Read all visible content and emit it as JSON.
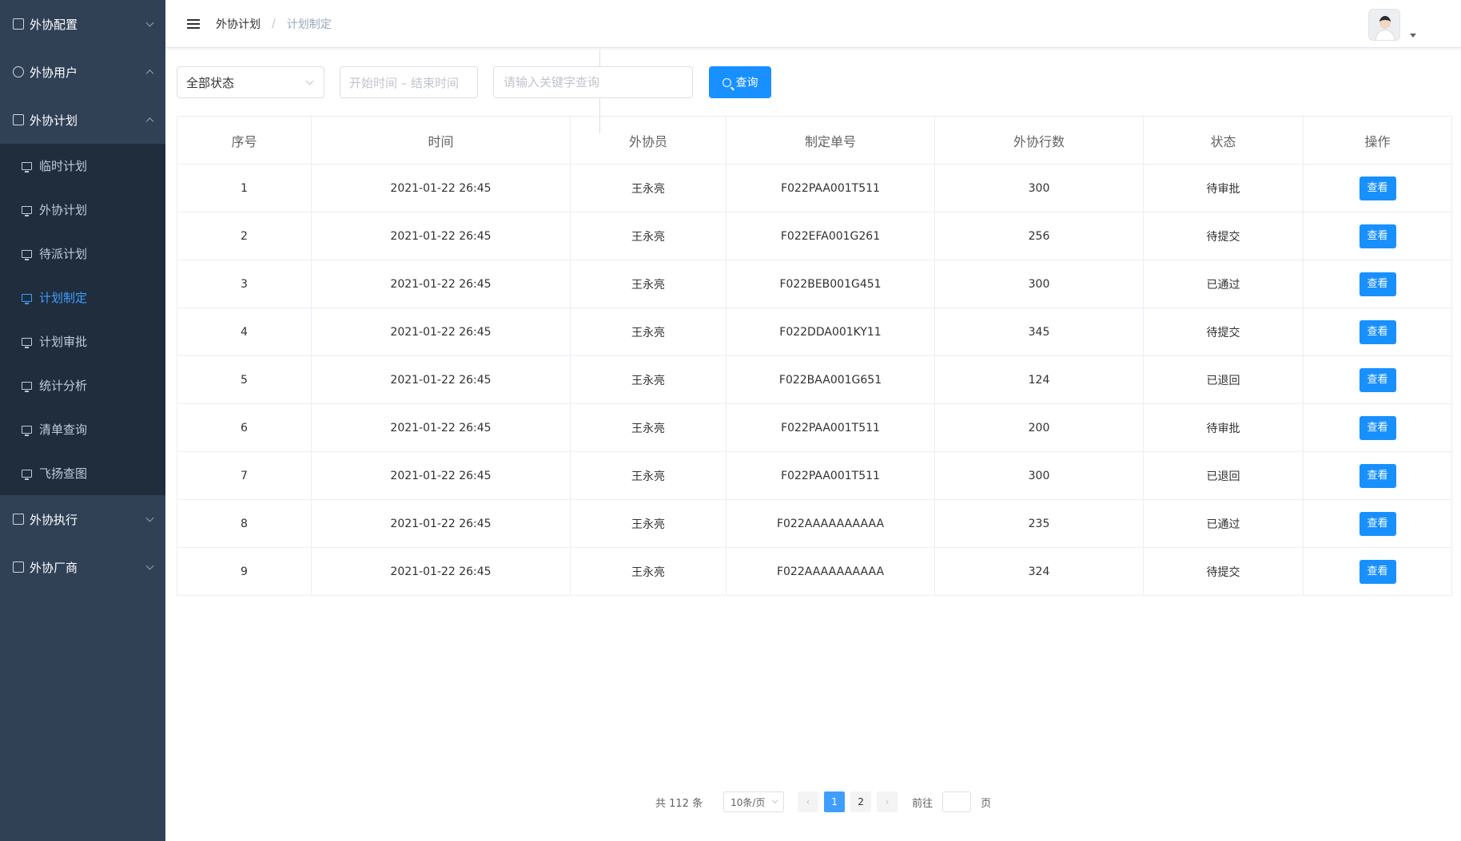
{
  "sidebar": {
    "groups": [
      {
        "label": "外协配置",
        "icon": "monitor-icon",
        "expanded": false
      },
      {
        "label": "外协用户",
        "icon": "user-icon",
        "expanded": true
      },
      {
        "label": "外协计划",
        "icon": "calendar-icon",
        "expanded": true
      },
      {
        "label": "外协执行",
        "icon": "hourglass-icon",
        "expanded": false
      },
      {
        "label": "外协厂商",
        "icon": "vendor-icon",
        "expanded": false
      }
    ],
    "plan_items": [
      "临时计划",
      "外协计划",
      "待派计划",
      "计划制定",
      "计划审批",
      "统计分析",
      "清单查询",
      "飞扬查图"
    ],
    "active_item": "计划制定"
  },
  "navbar": {
    "breadcrumb": [
      "外协计划",
      "计划制定"
    ],
    "breadcrumb_sep": "/"
  },
  "filters": {
    "status_value": "全部状态",
    "date_placeholder": "开始时间 – 结束时间",
    "keyword_placeholder": "请输入关键字查询",
    "search_label": "查询"
  },
  "table": {
    "headers": [
      "序号",
      "时间",
      "外协员",
      "制定单号",
      "外协行数",
      "状态",
      "操作"
    ],
    "rows": [
      {
        "no": "1",
        "time": "2021-01-22  26:45",
        "staff": "王永亮",
        "order": "F022PAA001T511",
        "lines": "300",
        "status": "待审批",
        "status_color": "#e6a23c"
      },
      {
        "no": "2",
        "time": "2021-01-22  26:45",
        "staff": "王永亮",
        "order": "F022EFA001G261",
        "lines": "256",
        "status": "待提交",
        "status_color": "#e6a23c"
      },
      {
        "no": "3",
        "time": "2021-01-22  26:45",
        "staff": "王永亮",
        "order": "F022BEB001G451",
        "lines": "300",
        "status": "已通过",
        "status_color": "#67c23a"
      },
      {
        "no": "4",
        "time": "2021-01-22  26:45",
        "staff": "王永亮",
        "order": "F022DDA001KY11",
        "lines": "345",
        "status": "待提交",
        "status_color": "#e6a23c"
      },
      {
        "no": "5",
        "time": "2021-01-22  26:45",
        "staff": "王永亮",
        "order": "F022BAA001G651",
        "lines": "124",
        "status": "已退回",
        "status_color": "#f56c6c"
      },
      {
        "no": "6",
        "time": "2021-01-22  26:45",
        "staff": "王永亮",
        "order": "F022PAA001T511",
        "lines": "200",
        "status": "待审批",
        "status_color": "#e6a23c"
      },
      {
        "no": "7",
        "time": "2021-01-22  26:45",
        "staff": "王永亮",
        "order": "F022PAA001T511",
        "lines": "300",
        "status": "已退回",
        "status_color": "#f56c6c"
      },
      {
        "no": "8",
        "time": "2021-01-22  26:45",
        "staff": "王永亮",
        "order": "F022AAAAAAAAAA",
        "lines": "235",
        "status": "已通过",
        "status_color": "#67c23a"
      },
      {
        "no": "9",
        "time": "2021-01-22  26:45",
        "staff": "王永亮",
        "order": "F022AAAAAAAAAA",
        "lines": "324",
        "status": "待提交",
        "status_color": "#e6a23c"
      }
    ],
    "view_label": "查看"
  },
  "pagination": {
    "total_text": "共 112 条",
    "page_size": "10条/页",
    "prev": "‹",
    "next": "›",
    "pages": [
      "1",
      "2"
    ],
    "current_page": "1",
    "goto_label": "前往",
    "page_unit": "页"
  },
  "colors": {
    "sidebar_bg": "#304156",
    "submenu_bg": "#1f2d3d",
    "accent": "#409eff",
    "primary_button": "#1890ff"
  }
}
